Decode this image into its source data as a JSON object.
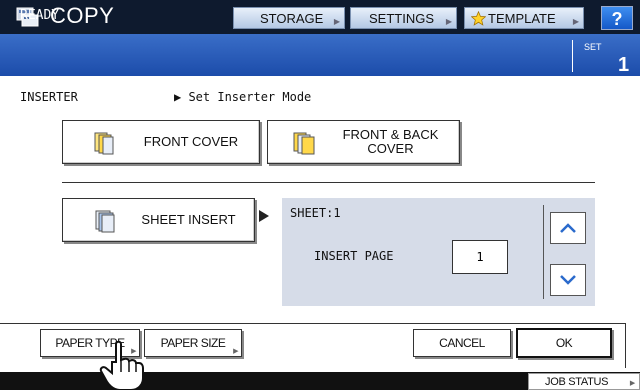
{
  "header": {
    "title": "COPY",
    "tabs": [
      {
        "label": "STORAGE"
      },
      {
        "label": "SETTINGS"
      },
      {
        "label": "TEMPLATE"
      }
    ],
    "help_label": "?"
  },
  "status": {
    "message": "READY",
    "set_label": "SET",
    "set_count": "1"
  },
  "breadcrumb": {
    "section": "INSERTER",
    "mode": "▶ Set Inserter Mode"
  },
  "options": {
    "front_cover": "FRONT COVER",
    "front_back_cover_line1": "FRONT & BACK",
    "front_back_cover_line2": "COVER",
    "sheet_insert": "SHEET INSERT"
  },
  "sheet_panel": {
    "sheet_label": "SHEET:1",
    "insert_page_label": "INSERT PAGE",
    "insert_page_value": "1"
  },
  "actions": {
    "paper_type": "PAPER TYPE",
    "paper_size": "PAPER SIZE",
    "cancel": "CANCEL",
    "ok": "OK"
  },
  "footer": {
    "job_status": "JOB STATUS"
  },
  "icons": {
    "app": "copy-icon",
    "front_cover": "front-cover-icon",
    "front_back_cover": "front-back-cover-icon",
    "sheet_insert": "sheet-insert-icon",
    "template": "star-icon",
    "up": "chevron-up-icon",
    "down": "chevron-down-icon",
    "pointer": "hand-pointer-icon"
  },
  "colors": {
    "header_bg": "#0e1a2e",
    "status_bg": "#2a5cb8",
    "panel_bg": "#d6dce8",
    "help_bg": "#1e6ee0"
  }
}
